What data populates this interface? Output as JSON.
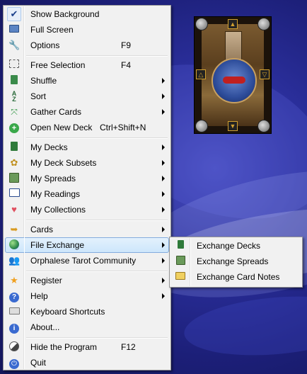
{
  "menu": {
    "items": [
      {
        "label": "Show Background",
        "shortcut": "",
        "icon": "checkmark-icon"
      },
      {
        "label": "Full Screen",
        "shortcut": "",
        "icon": "monitor-icon"
      },
      {
        "label": "Options",
        "shortcut": "F9",
        "icon": "wrench-icon"
      },
      {
        "label": "Free Selection",
        "shortcut": "F4",
        "icon": "selection-icon"
      },
      {
        "label": "Shuffle",
        "shortcut": "",
        "icon": "shuffle-icon"
      },
      {
        "label": "Sort",
        "shortcut": "",
        "icon": "sort-az-icon"
      },
      {
        "label": "Gather Cards",
        "shortcut": "",
        "icon": "gather-icon"
      },
      {
        "label": "Open New Deck",
        "shortcut": "Ctrl+Shift+N",
        "icon": "add-circle-icon"
      },
      {
        "label": "My Decks",
        "shortcut": "",
        "icon": "deck-icon"
      },
      {
        "label": "My Deck Subsets",
        "shortcut": "",
        "icon": "flower-icon"
      },
      {
        "label": "My Spreads",
        "shortcut": "",
        "icon": "spread-grid-icon"
      },
      {
        "label": "My Readings",
        "shortcut": "",
        "icon": "book-icon"
      },
      {
        "label": "My Collections",
        "shortcut": "",
        "icon": "heart-icon"
      },
      {
        "label": "Cards",
        "shortcut": "",
        "icon": "cards-arrow-icon"
      },
      {
        "label": "File Exchange",
        "shortcut": "",
        "icon": "globe-icon"
      },
      {
        "label": "Orphalese Tarot Community",
        "shortcut": "",
        "icon": "community-icon"
      },
      {
        "label": "Register",
        "shortcut": "",
        "icon": "star-icon"
      },
      {
        "label": "Help",
        "shortcut": "",
        "icon": "help-icon"
      },
      {
        "label": "Keyboard Shortcuts",
        "shortcut": "",
        "icon": "keyboard-icon"
      },
      {
        "label": "About...",
        "shortcut": "",
        "icon": "info-icon"
      },
      {
        "label": "Hide the Program",
        "shortcut": "F12",
        "icon": "hide-icon"
      },
      {
        "label": "Quit",
        "shortcut": "",
        "icon": "power-icon"
      }
    ]
  },
  "submenu": {
    "items": [
      {
        "label": "Exchange Decks",
        "icon": "exchange-decks-icon"
      },
      {
        "label": "Exchange Spreads",
        "icon": "exchange-spreads-icon"
      },
      {
        "label": "Exchange Card Notes",
        "icon": "exchange-notes-icon"
      }
    ]
  },
  "colors": {
    "menu_bg": "#f1f1f1",
    "highlight_bg": "#cde6fb",
    "highlight_border": "#84acdd",
    "desktop": "#2a2e9a"
  }
}
